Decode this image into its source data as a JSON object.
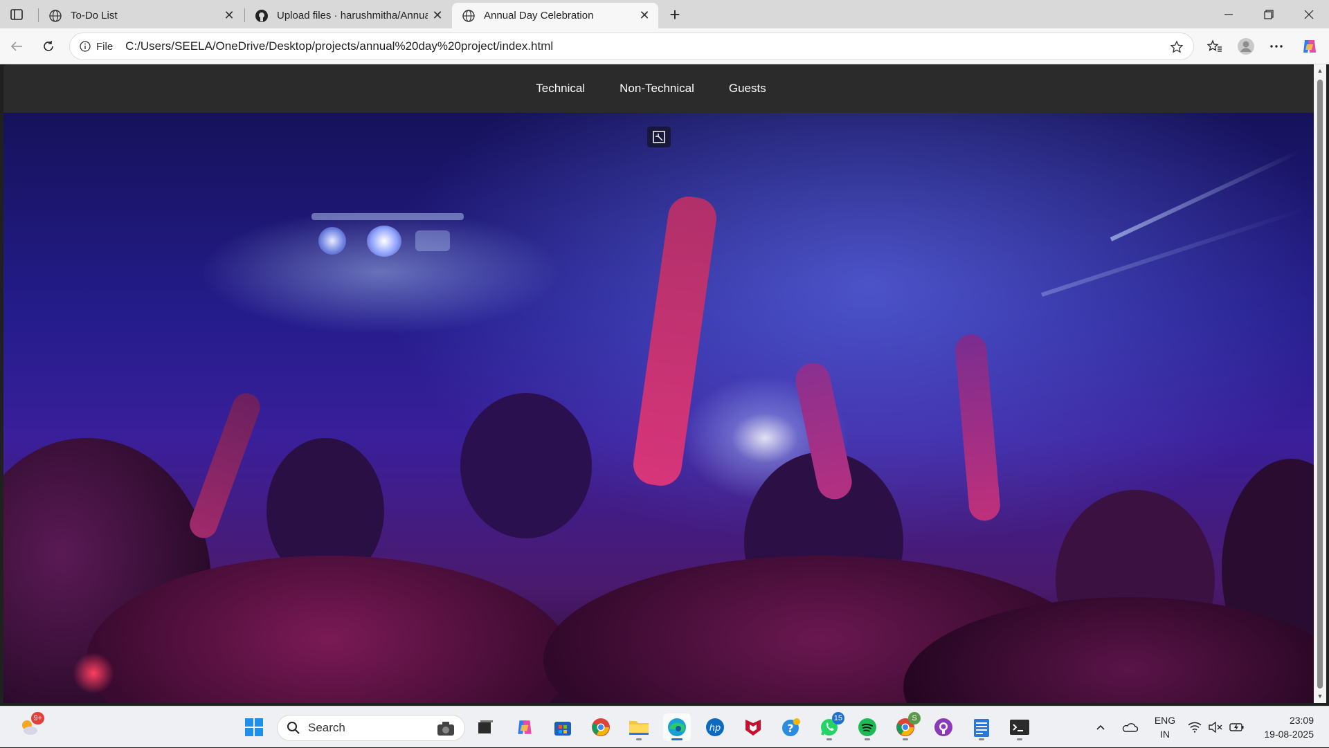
{
  "tabs": [
    {
      "title": "To-Do List",
      "icon": "globe-icon"
    },
    {
      "title": "Upload files · harushmitha/Annua",
      "icon": "github-icon"
    },
    {
      "title": "Annual Day Celebration",
      "icon": "globe-icon",
      "active": true
    }
  ],
  "address_bar": {
    "scheme_label": "File",
    "url": "C:/Users/SEELA/OneDrive/Desktop/projects/annual%20day%20project/index.html"
  },
  "page": {
    "nav": [
      "Technical",
      "Non-Technical",
      "Guests"
    ],
    "hero": {
      "media": "concert-crowd-video",
      "control_icon": "exit-fullscreen-icon"
    }
  },
  "taskbar": {
    "weather_badge": "9+",
    "search_placeholder": "Search",
    "whatsapp_badge": "15",
    "chrome_badge": "S",
    "apps": [
      "windows-start-icon",
      "task-view-icon",
      "copilot-icon",
      "store-icon",
      "chrome-icon",
      "file-explorer-icon",
      "edge-icon",
      "hp-icon",
      "mcafee-icon",
      "help-icon",
      "whatsapp-icon",
      "spotify-icon",
      "chrome-profile-icon",
      "github-desktop-icon",
      "notepad-icon",
      "terminal-icon"
    ]
  },
  "tray": {
    "lang_top": "ENG",
    "lang_bottom": "IN",
    "time": "23:09",
    "date": "19-08-2025"
  },
  "colors": {
    "navbar": "#2b2b2b",
    "accent": "#1f6fd1"
  }
}
